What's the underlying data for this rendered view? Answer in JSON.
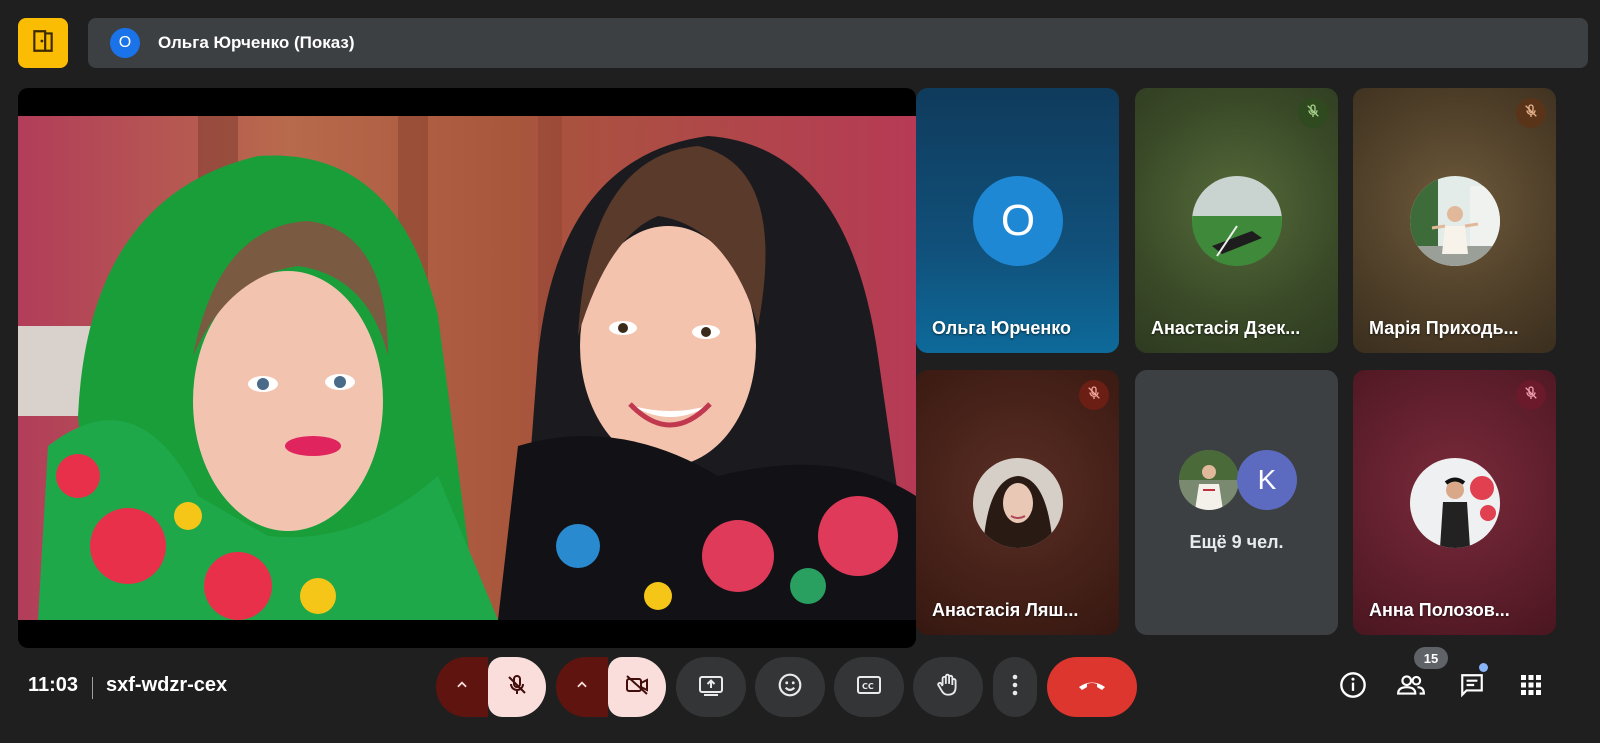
{
  "top": {
    "presenter_initial": "О",
    "presenter_label": "Ольга Юрченко (Показ)"
  },
  "tiles": [
    {
      "name": "Ольга Юрченко",
      "initial": "О",
      "muted": false
    },
    {
      "name": "Анастасія Дзек...",
      "muted": true
    },
    {
      "name": "Марія Приходь...",
      "muted": true
    },
    {
      "name": "Анастасія Ляш...",
      "muted": true
    },
    {
      "name": "Анна Полозов...",
      "muted": true
    }
  ],
  "overflow_tile": {
    "initial": "K",
    "label": "Ещё 9 чел."
  },
  "bottom": {
    "time": "11:03",
    "meeting_code": "sxf-wdzr-cex",
    "participants_count": "15"
  },
  "icons": {
    "app": "door-icon",
    "mic": "mic-off-icon",
    "camera": "camera-off-icon",
    "present": "present-screen-icon",
    "emoji": "emoji-icon",
    "captions": "captions-icon",
    "hand": "raise-hand-icon",
    "more": "more-vert-icon",
    "end": "end-call-icon",
    "info": "info-icon",
    "people": "people-icon",
    "chat": "chat-icon",
    "activities": "apps-grid-icon"
  },
  "colors": {
    "background": "#1f1f1f",
    "accent_yellow": "#fbbc04",
    "accent_blue": "#1a73e8",
    "end_call_red": "#dc362e",
    "muted_dark_red": "#601410",
    "muted_light": "#f9dedc"
  }
}
